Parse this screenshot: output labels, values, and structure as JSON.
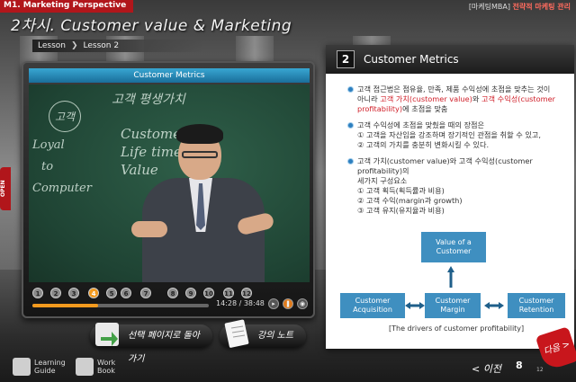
{
  "header": {
    "course_label": "M1. Marketing Perspective",
    "title": "2차시. Customer value & Marketing",
    "right_prefix": "[마케팅MBA]",
    "right_suffix": "전략적 마케팅 관리"
  },
  "breadcrumb": {
    "lesson": "Lesson",
    "current": "Lesson 2"
  },
  "video": {
    "title": "Customer Metrics",
    "time": "14:28 / 38:48",
    "progress": 0.37,
    "markers": [
      "1",
      "2",
      "3",
      "4",
      "5",
      "6",
      "7",
      "8",
      "9",
      "10",
      "11",
      "12"
    ],
    "active_marker": "4",
    "chalk": [
      "고객 평생가치",
      "Customer",
      "Life time",
      "Value",
      "Loyal",
      "to",
      "Computer",
      "고객"
    ]
  },
  "buttons": {
    "select_page": "선택 페이지로 돌아가기",
    "notes": "강의 노트"
  },
  "guides": {
    "learning": [
      "Learning",
      "Guide"
    ],
    "workbook": [
      "Work",
      "Book"
    ]
  },
  "side_tab": "OPEN",
  "panel": {
    "number": "2",
    "title": "Customer Metrics",
    "bullets": [
      {
        "line1": "고객 접근법은 점유율, 만족, 제품 수익성에 초점을 맞추는 것이",
        "line2_pre": "아니라 ",
        "red1": "고객 가치(customer value)",
        "mid": "와 ",
        "red2": "고객 수익성(customer profitability)",
        "post": "에 초점을 맞춤"
      },
      {
        "line1": "고객 수익성에 초점을 맞췄을 때의 장점은",
        "line2": "① 고객을 자산임을 강조하며 장기적인 관점을 취할 수 있고,",
        "line3": "② 고객의 가치를 충분히 변화시킬 수 있다."
      },
      {
        "line1": "고객 가치(customer value)와 고객 수익성(customer profitability)의",
        "line2": "세가지 구성요소",
        "line3": "① 고객 획득(획득률과 비용)",
        "line4": "② 고객 수익(margin과 growth)",
        "line5": "③ 고객 유지(유지율과 비용)"
      }
    ],
    "diagram": {
      "top": "Value of a Customer",
      "left": "Customer Acquisition",
      "center": "Customer Margin",
      "right": "Customer Retention",
      "caption": "[The drivers of customer profitability]"
    }
  },
  "nav": {
    "prev": "< 이전",
    "page": "8",
    "total": "12",
    "next": "다음 >"
  },
  "colors": {
    "accent_red": "#b1161b",
    "box_blue": "#3f8fc0",
    "orange": "#f39a1e"
  }
}
